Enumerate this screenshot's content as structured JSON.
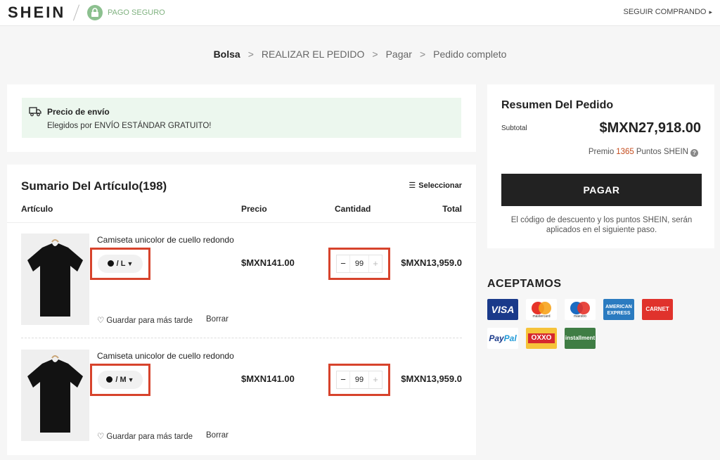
{
  "header": {
    "logo": "SHEIN",
    "secure_label": "PAGO SEGURO",
    "continue_label": "SEGUIR COMPRANDO"
  },
  "breadcrumb": {
    "steps": [
      "Bolsa",
      "REALIZAR EL PEDIDO",
      "Pagar",
      "Pedido completo"
    ],
    "separator": ">"
  },
  "shipping": {
    "title": "Precio de envío",
    "subtitle": "Elegidos por ENVÍO ESTÁNDAR GRATUITO!"
  },
  "items": {
    "title": "Sumario Del Artículo(198)",
    "select_label": "Seleccionar",
    "columns": {
      "article": "Artículo",
      "price": "Precio",
      "quantity": "Cantidad",
      "total": "Total"
    },
    "rows": [
      {
        "name": "Camiseta unicolor de cuello redondo",
        "size": "/ L",
        "price": "$MXN141.00",
        "quantity": "99",
        "total": "$MXN13,959.0",
        "save_label": "Guardar para más tarde",
        "delete_label": "Borrar"
      },
      {
        "name": "Camiseta unicolor de cuello redondo",
        "size": "/ M",
        "price": "$MXN141.00",
        "quantity": "99",
        "total": "$MXN13,959.0",
        "save_label": "Guardar para más tarde",
        "delete_label": "Borrar"
      }
    ]
  },
  "summary": {
    "title": "Resumen Del Pedido",
    "subtotal_label": "Subtotal",
    "subtotal_value": "$MXN27,918.00",
    "reward_prefix": "Premio",
    "reward_points": "1365",
    "reward_suffix": "Puntos SHEIN",
    "pay_label": "PAGAR",
    "note": "El código de descuento y los puntos SHEIN, serán aplicados en el siguiente paso."
  },
  "payments": {
    "title": "ACEPTAMOS",
    "visa": "VISA",
    "mastercard": "mastercard",
    "maestro": "maestro",
    "amex_1": "AMERICAN",
    "amex_2": "EXPRESS",
    "carnet": "CARNET",
    "paypal_1": "Pay",
    "paypal_2": "Pal",
    "oxxo": "OXXO",
    "installment": "installment"
  },
  "colors": {
    "highlight": "#d7432c",
    "shipping_bg": "#ecf7ee",
    "points": "#c44a1b"
  }
}
